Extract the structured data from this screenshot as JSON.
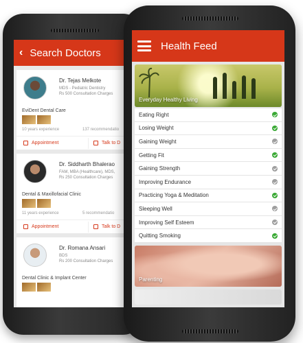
{
  "search_doctors": {
    "title": "Search Doctors",
    "doctors": [
      {
        "name": "Dr. Tejas Melkote",
        "qualification": "MDS - Pediatric Dentistry",
        "fee": "Rs 500 Consultation Charges",
        "clinic": "EviDent Dental Care",
        "experience": "10 years experience",
        "recommendations": "137 recommendatio"
      },
      {
        "name": "Dr. Siddharth Bhalerao",
        "qualification": "FAM, MBA (Healthcare), MDS,",
        "fee": "Rs 250 Consultation Charges",
        "clinic": "Dental & Maxillofacial Clinic",
        "experience": "11 years experience",
        "recommendations": "5 recommendatio"
      },
      {
        "name": "Dr. Romana Ansari",
        "qualification": "BDS",
        "fee": "Rs 200 Consultation Charges",
        "clinic": "Dental Clinic & Implant Center",
        "experience": "",
        "recommendations": ""
      }
    ],
    "appointment_label": "Appointment",
    "talk_label": "Talk to D"
  },
  "health_feed": {
    "title": "Health Feed",
    "banner_top": "Everyday Healthy Living",
    "topics": [
      {
        "label": "Eating Right",
        "checked": true
      },
      {
        "label": "Losing Weight",
        "checked": true
      },
      {
        "label": "Gaining Weight",
        "checked": false
      },
      {
        "label": "Getting Fit",
        "checked": true
      },
      {
        "label": "Gaining Strength",
        "checked": false
      },
      {
        "label": "Improving Endurance",
        "checked": false
      },
      {
        "label": "Practicing Yoga & Meditation",
        "checked": true
      },
      {
        "label": "Sleeping Well",
        "checked": false
      },
      {
        "label": "Improving Self Esteem",
        "checked": false
      },
      {
        "label": "Quitting Smoking",
        "checked": true
      }
    ],
    "banner_bottom": "Parenting"
  },
  "colors": {
    "brand_red": "#d63719",
    "check_green": "#3aa935",
    "check_gray": "#9e9e9e"
  }
}
